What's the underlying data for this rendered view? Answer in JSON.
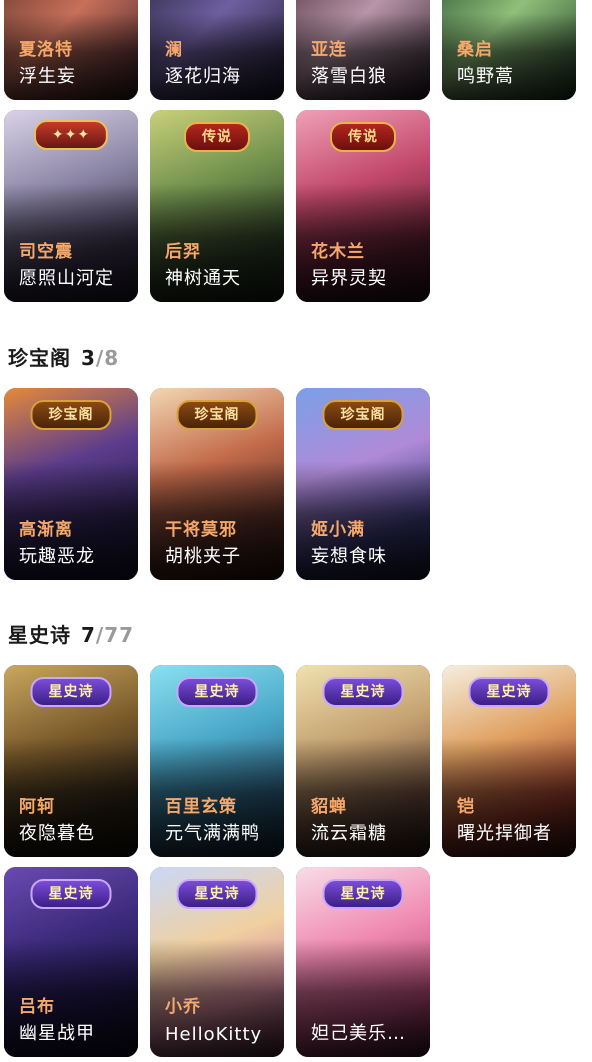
{
  "top_rows": {
    "row1": [
      {
        "hero": "夏洛特",
        "skin": "浮生妄"
      },
      {
        "hero": "澜",
        "skin": "逐花归海"
      },
      {
        "hero": "亚连",
        "skin": "落雪白狼"
      },
      {
        "hero": "桑启",
        "skin": "鸣野蒿"
      }
    ],
    "row2": [
      {
        "hero": "司空震",
        "skin": "愿照山河定"
      },
      {
        "hero": "后羿",
        "skin": "神树通天",
        "badge": "传说"
      },
      {
        "hero": "花木兰",
        "skin": "异界灵契",
        "badge": "传说"
      }
    ]
  },
  "sections": [
    {
      "title": "珍宝阁",
      "owned": "3",
      "total": "/8",
      "cards": [
        {
          "hero": "高渐离",
          "skin": "玩趣恶龙",
          "badge": "珍宝阁"
        },
        {
          "hero": "干将莫邪",
          "skin": "胡桃夹子",
          "badge": "珍宝阁"
        },
        {
          "hero": "姬小满",
          "skin": "妄想食味",
          "badge": "珍宝阁"
        }
      ]
    },
    {
      "title": "星史诗",
      "owned": "7",
      "total": "/77",
      "cards": [
        {
          "hero": "阿轲",
          "skin": "夜隐暮色",
          "badge": "星史诗"
        },
        {
          "hero": "百里玄策",
          "skin": "元气满满鸭",
          "badge": "星史诗"
        },
        {
          "hero": "貂蝉",
          "skin": "流云霜糖",
          "badge": "星史诗"
        },
        {
          "hero": "铠",
          "skin": "曙光捍御者",
          "badge": "星史诗"
        },
        {
          "hero": "吕布",
          "skin": "幽星战甲",
          "badge": "星史诗"
        },
        {
          "hero": "小乔",
          "skin": "HelloKitty",
          "badge": "星史诗"
        },
        {
          "hero": "妲己美乐蒂…",
          "skin": "妲己美乐蒂…",
          "badge": "星史诗"
        }
      ]
    }
  ],
  "colors": {
    "hero_name": "#f6a86b",
    "skin_name": "#ffffff",
    "count_total": "#9a9a9a"
  }
}
